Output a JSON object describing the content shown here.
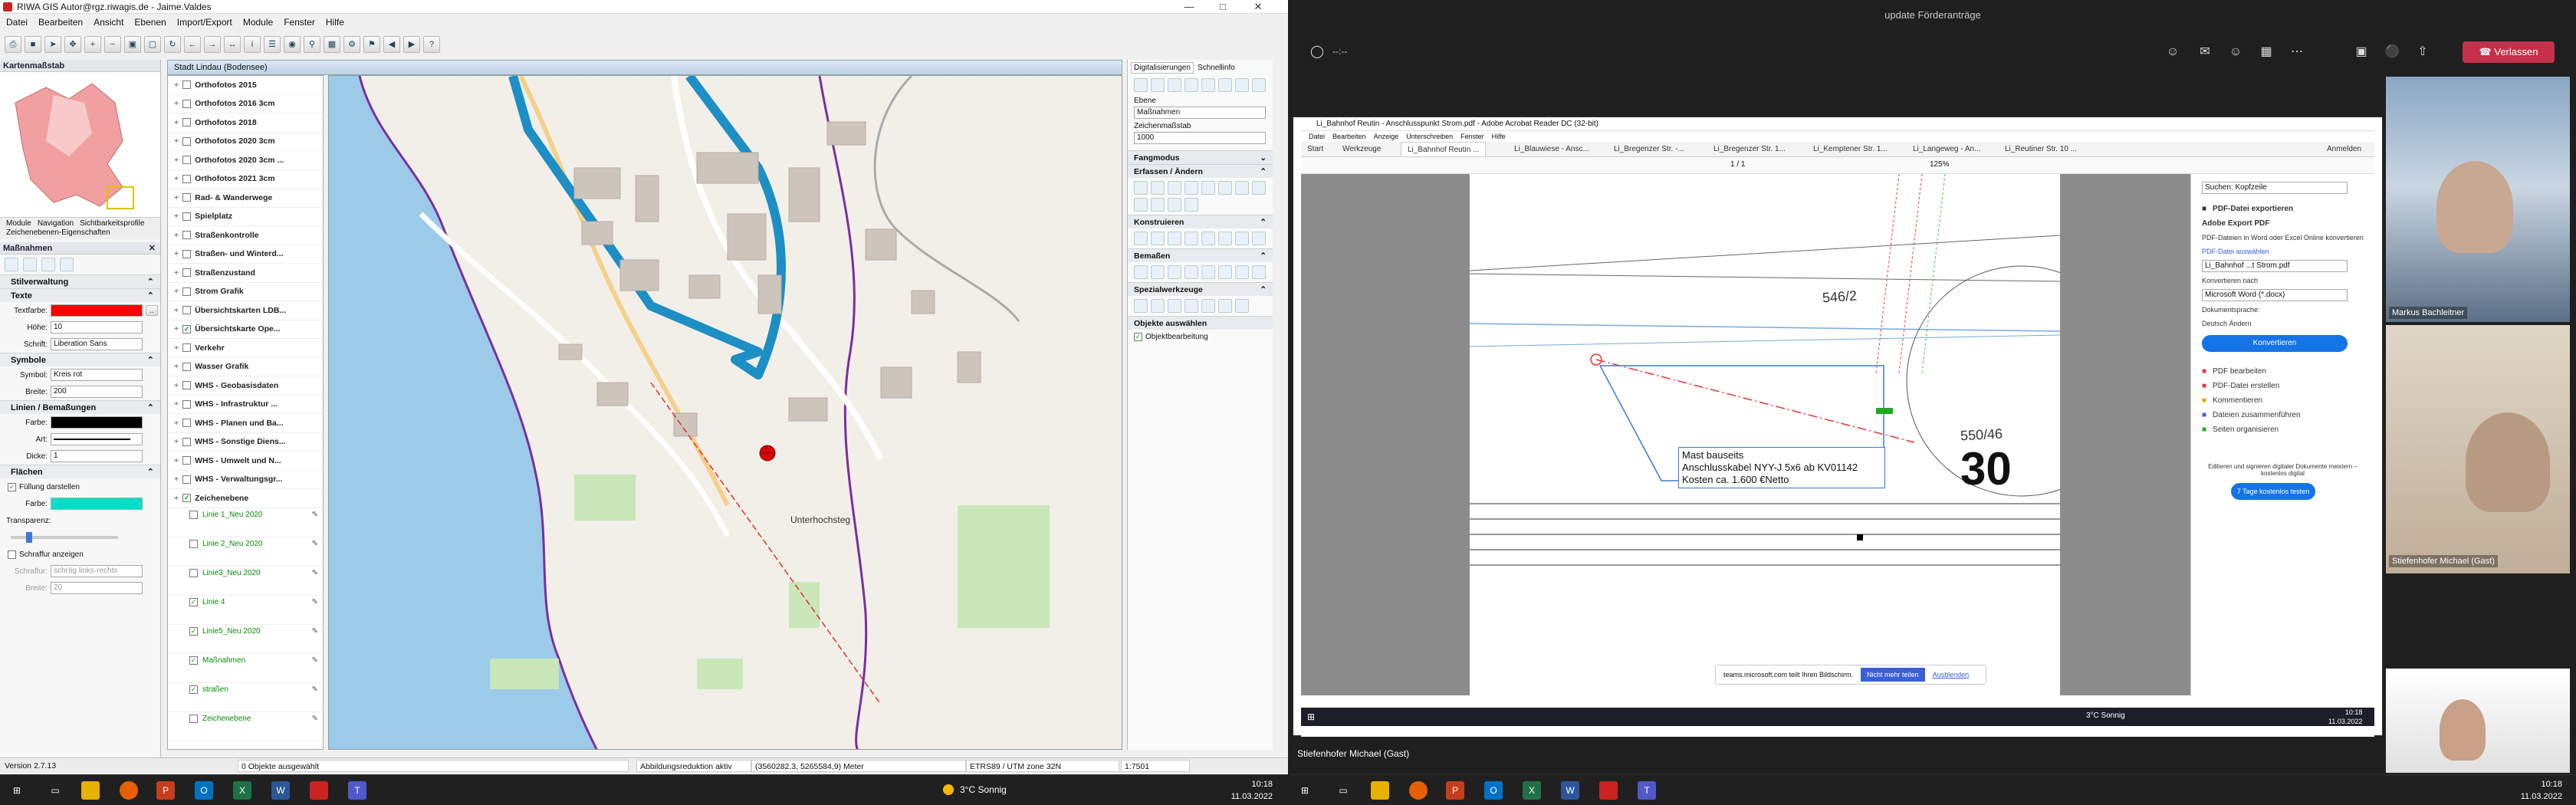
{
  "gis": {
    "title": "RIWA GIS Autor@rgz.riwagis.de - Jaime.Valdes",
    "menu": [
      "Datei",
      "Bearbeiten",
      "Ansicht",
      "Ebenen",
      "Import/Export",
      "Module",
      "Fenster",
      "Hilfe"
    ],
    "overview_title": "Kartenmaßstab",
    "tabs": [
      "Module",
      "Navigation",
      "Sichtbarkeitsprofile"
    ],
    "tab_sub": "Zeichenebenen-Eigenschaften",
    "panel_title": "Maßnahmen",
    "sections": {
      "style": "Stilverwaltung",
      "text": "Texte",
      "symbols": "Symbole",
      "lines": "Linien / Bemaßungen",
      "areas": "Flächen"
    },
    "fields": {
      "text_color_label": "Textfarbe:",
      "height_label": "Höhe:",
      "height_value": "10",
      "font_label": "Schrift:",
      "font_value": "Liberation Sans",
      "symbol_label": "Symbol:",
      "symbol_value": "Kreis rot",
      "width_label": "Breite:",
      "width_value": "200",
      "color_label": "Farbe:",
      "type_label": "Art:",
      "thickness_label": "Dicke:",
      "thickness_value": "1",
      "fill_label": "Füllung darstellen",
      "fill_color_label": "Farbe:",
      "transparency_label": "Transparenz:",
      "hatch_label": "Schraffur anzeigen",
      "hatch_label2": "Schraffur:",
      "hatch_value": "schräg links-rechts",
      "hatch_width_label": "Breite:",
      "hatch_width_value": "20"
    },
    "colors": {
      "text_red": "#ff0000",
      "line_black": "#000000",
      "fill_cyan": "#00e0c8",
      "route_blue": "#1d8fc4",
      "accent": "#e8a020"
    },
    "map_title": "Stadt Lindau (Bodensee)",
    "map_label": "Unterhochsteg",
    "layers": [
      {
        "name": "Orthofotos 2015",
        "checked": false
      },
      {
        "name": "Orthofotos 2016 3cm",
        "checked": false
      },
      {
        "name": "Orthofotos 2018",
        "checked": false
      },
      {
        "name": "Orthofotos 2020 3cm",
        "checked": false
      },
      {
        "name": "Orthofotos 2020 3cm ...",
        "checked": false
      },
      {
        "name": "Orthofotos 2021 3cm",
        "checked": false
      },
      {
        "name": "Rad- & Wanderwege",
        "checked": false
      },
      {
        "name": "Spielplatz",
        "checked": false
      },
      {
        "name": "Straßenkontrolle",
        "checked": false
      },
      {
        "name": "Straßen- und Winterd...",
        "checked": false
      },
      {
        "name": "Straßenzustand",
        "checked": false
      },
      {
        "name": "Strom Grafik",
        "checked": false
      },
      {
        "name": "Übersichtskarten LDB...",
        "checked": false
      },
      {
        "name": "Übersichtskarte Ope...",
        "checked": true
      },
      {
        "name": "Verkehr",
        "checked": false
      },
      {
        "name": "Wasser Grafik",
        "checked": false
      },
      {
        "name": "WHS - Geobasisdaten",
        "checked": false
      },
      {
        "name": "WHS - Infrastruktur ...",
        "checked": false
      },
      {
        "name": "WHS - Planen und Ba...",
        "checked": false
      },
      {
        "name": "WHS - Sonstige Diens...",
        "checked": false
      },
      {
        "name": "WHS - Umwelt und N...",
        "checked": false
      },
      {
        "name": "WHS - Verwaltungsgr...",
        "checked": false
      },
      {
        "name": "Zeichenebene",
        "checked": true
      }
    ],
    "sublayers": [
      {
        "name": "Linie 1_Neu 2020",
        "checked": false
      },
      {
        "name": "Linie 2_Neu 2020",
        "checked": false
      },
      {
        "name": "Linie3_Neu 2020",
        "checked": false
      },
      {
        "name": "Linie 4",
        "checked": true
      },
      {
        "name": "Linie5_Neu 2020",
        "checked": true
      },
      {
        "name": "Maßnahmen",
        "checked": true
      },
      {
        "name": "straßen",
        "checked": true
      },
      {
        "name": "Zeichenebene",
        "checked": false
      }
    ],
    "right_tabs": [
      "Digitalisierungen",
      "Schnellinfo"
    ],
    "ebene_label": "Ebene",
    "ebene_value": "Maßnahmen",
    "scale_label": "Zeichenmaßstab",
    "scale_value": "1000",
    "right_sections": [
      "Fangmodus",
      "Erfassen / Ändern",
      "Konstruieren",
      "Bemaßen",
      "Spezialwerkzeuge",
      "Objekte auswählen"
    ],
    "obj_edit": "Objektbearbeitung",
    "status": {
      "version": "Version 2.7.13",
      "selected": "0 Objekte ausgewählt",
      "reduction": "Abbildungsreduktion aktiv",
      "coords": "(3560282,3, 5265584,9) Meter",
      "crs": "ETRS89 / UTM zone 32N",
      "scale": "1:7501"
    }
  },
  "teams": {
    "title": "update Förderanträge",
    "timer": "--:--",
    "leave_label": "Verlassen",
    "acrobat": {
      "title": "Li_Bahnhof Reutin - Anschlusspunkt Strom.pdf - Adobe Acrobat Reader DC (32-bit)",
      "menu": [
        "Datei",
        "Bearbeiten",
        "Anzeige",
        "Unterschreiben",
        "Fenster",
        "Hilfe"
      ],
      "tabs": [
        "Start",
        "Werkzeuge",
        "Li_Bahnhof Reutin ...",
        "Li_Blauwiese - Ansc...",
        "Li_Bregenzer Str. -...",
        "Li_Bregenzer Str. 1...",
        "Li_Kemptener Str. 1...",
        "Li_Langeweg - An...",
        "Li_Reutiner Str. 10 ..."
      ],
      "signin": "Anmelden",
      "page_info": "1 / 1",
      "zoom": "125%",
      "plan_labels": {
        "parcel1": "546/2",
        "parcel2": "550/46",
        "big": "30"
      },
      "annotation": [
        "Mast bauseits",
        "Anschlusskabel NYY-J 5x6 ab KV01142",
        "Kosten ca. 1.600 €Netto"
      ],
      "side": {
        "search": "Suchen: Kopfzeile",
        "export_title": "PDF-Datei exportieren",
        "adobe_export": "Adobe Export PDF",
        "export_desc": "PDF-Dateien in Word oder Excel Online konvertieren",
        "select_label": "PDF-Datei auswählen",
        "file_value": "Li_Bahnhof ...t Strom.pdf",
        "convert_to": "Konvertieren nach",
        "format_value": "Microsoft Word (*.docx)",
        "doc_lang_label": "Dokumentsprache:",
        "doc_lang_value": "Deutsch  Ändern",
        "convert_btn": "Konvertieren",
        "tools": [
          "PDF bearbeiten",
          "PDF-Datei erstellen",
          "Kommentieren",
          "Dateien zusammenführen",
          "Seiten organisieren"
        ],
        "promo": "Editieren und signieren digitaler Dokumente meistern – kostenlos digital",
        "trial_btn": "7 Tage kostenlos testen"
      },
      "share_notice": "teams.microsoft.com teilt Ihren Bildschirm.",
      "share_stop": "Nicht mehr teilen",
      "share_hide": "Ausblenden"
    },
    "remote_clock": {
      "time": "10:18",
      "date": "11.03.2022",
      "weather": "3°C  Sonnig"
    },
    "participants": [
      {
        "name": "Markus Bachleitner"
      },
      {
        "name": "Stiefenhofer Michael (Gast)"
      }
    ],
    "share_owner": "Stiefenhofer Michael (Gast)"
  },
  "taskbar": {
    "weather": "3°C  Sonnig",
    "time": "10:18",
    "date": "11.03.2022"
  }
}
